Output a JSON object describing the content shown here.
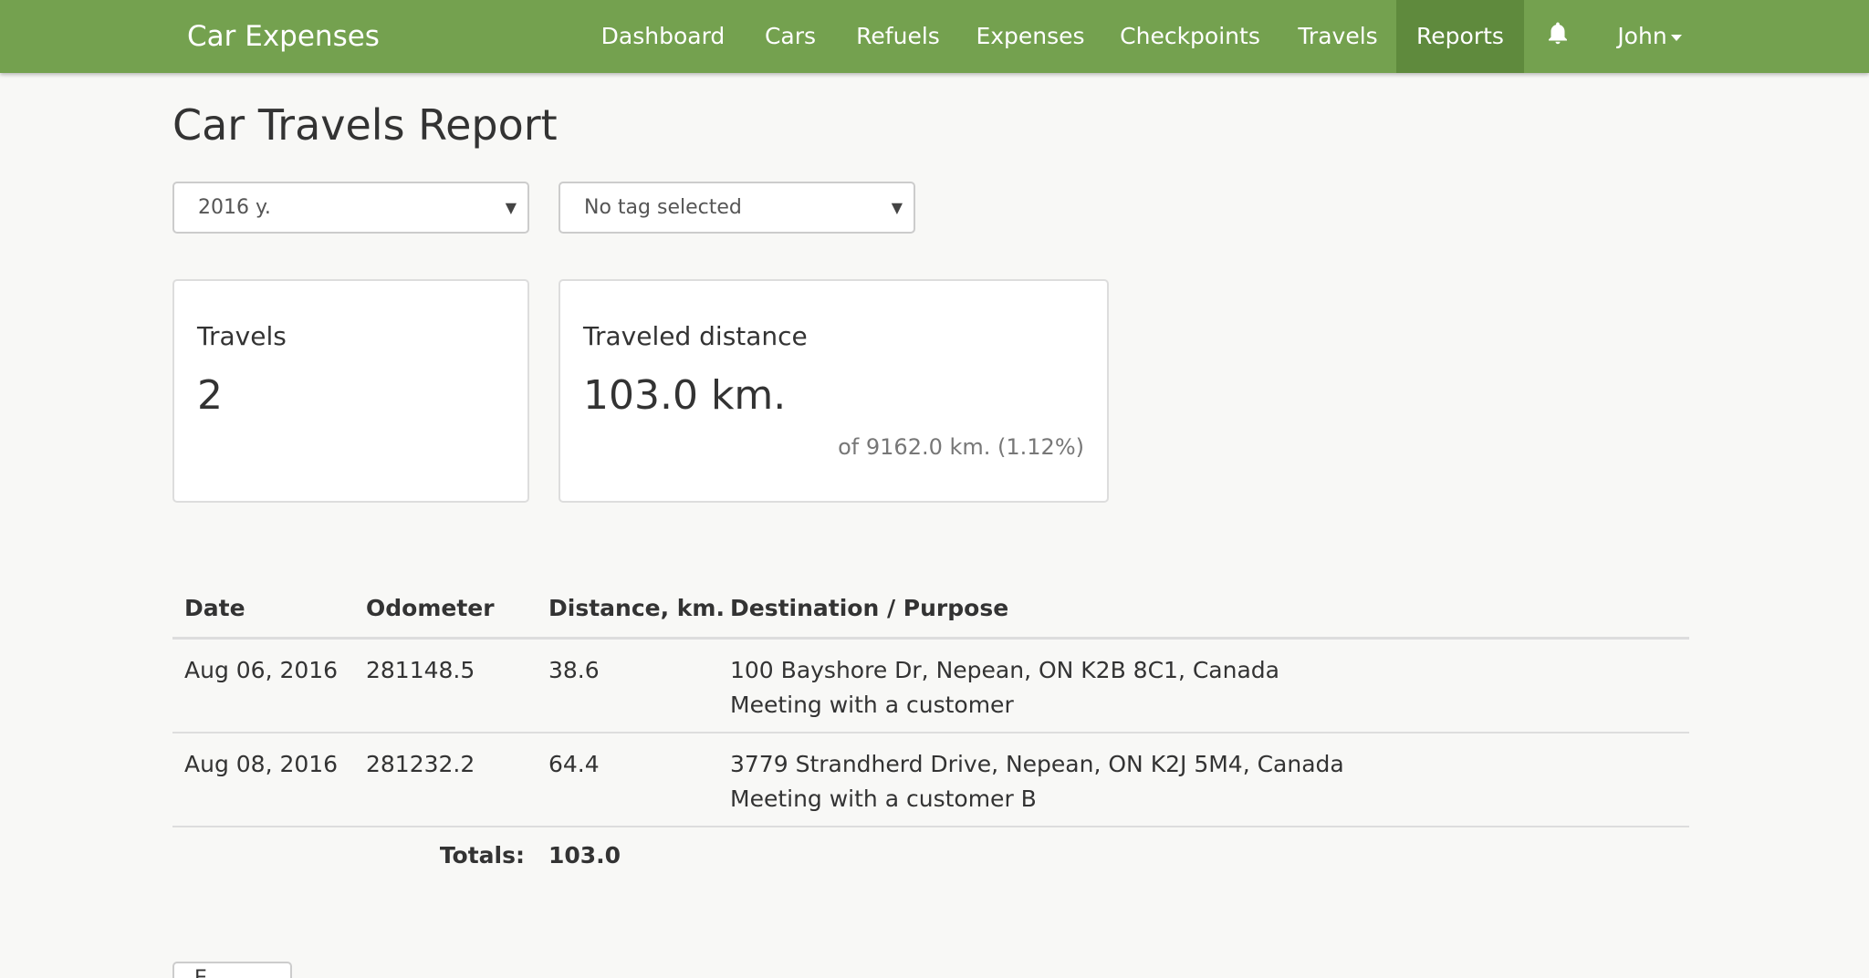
{
  "navbar": {
    "brand": "Car Expenses",
    "items": [
      "Dashboard",
      "Cars",
      "Refuels",
      "Expenses",
      "Checkpoints",
      "Travels",
      "Reports"
    ],
    "active": "Reports",
    "user": "John",
    "bell_icon": "bell-icon",
    "color": "#74a14f",
    "active_color": "#5f8a3d"
  },
  "page": {
    "title": "Car Travels Report"
  },
  "filters": {
    "year": "2016 y.",
    "tag": "No tag selected"
  },
  "cards": {
    "travels": {
      "title": "Travels",
      "value": "2"
    },
    "distance": {
      "title": "Traveled distance",
      "value": "103.0 km.",
      "sub": "of 9162.0 km. (1.12%)"
    }
  },
  "table": {
    "headers": [
      "Date",
      "Odometer",
      "Distance, km.",
      "Destination / Purpose"
    ],
    "rows": [
      {
        "date": "Aug 06, 2016",
        "odometer": "281148.5",
        "distance": "38.6",
        "destination": "100 Bayshore Dr, Nepean, ON K2B 8C1, Canada",
        "purpose": "Meeting with a customer"
      },
      {
        "date": "Aug 08, 2016",
        "odometer": "281232.2",
        "distance": "64.4",
        "destination": "3779 Strandherd Drive, Nepean, ON K2J 5M4, Canada",
        "purpose": "Meeting with a customer B"
      }
    ],
    "totals_label": "Totals:",
    "totals_value": "103.0"
  },
  "footer_button": {
    "label": "E..."
  }
}
